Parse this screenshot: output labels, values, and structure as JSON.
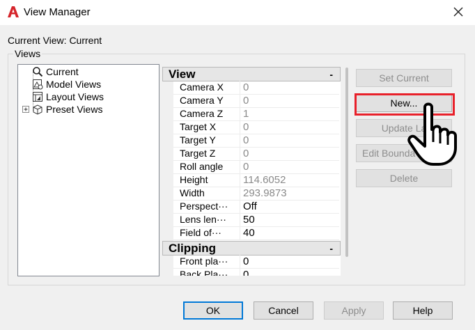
{
  "window": {
    "title": "View Manager",
    "app_icon": "autocad-a-icon",
    "close_icon": "close-icon"
  },
  "current_view_label": "Current View: Current",
  "views_group_label": "Views",
  "tree": {
    "items": [
      {
        "label": "Current",
        "icon": "magnifier-icon"
      },
      {
        "label": "Model Views",
        "icon": "model-views-icon"
      },
      {
        "label": "Layout Views",
        "icon": "layout-views-icon"
      },
      {
        "label": "Preset Views",
        "icon": "cube-icon",
        "expander": "+"
      }
    ]
  },
  "properties": {
    "view_category": "View",
    "clipping_category": "Clipping",
    "collapse_glyph": "-",
    "view_rows": [
      {
        "name": "Camera X",
        "value": "0"
      },
      {
        "name": "Camera Y",
        "value": "0"
      },
      {
        "name": "Camera Z",
        "value": "1"
      },
      {
        "name": "Target X",
        "value": "0"
      },
      {
        "name": "Target Y",
        "value": "0"
      },
      {
        "name": "Target Z",
        "value": "0"
      },
      {
        "name": "Roll angle",
        "value": "0"
      },
      {
        "name": "Height",
        "value": "114.6052"
      },
      {
        "name": "Width",
        "value": "293.9873"
      },
      {
        "name": "Perspect···",
        "value": "Off"
      },
      {
        "name": "Lens  len···",
        "value": "50"
      },
      {
        "name": "Field  of···",
        "value": "40"
      }
    ],
    "clipping_rows": [
      {
        "name": "Front  pla···",
        "value": "0"
      },
      {
        "name": "Back  Pla···",
        "value": "0"
      }
    ]
  },
  "side_buttons": {
    "set_current": "Set Current",
    "new": "New...",
    "update_layers": "Update La",
    "edit_boundaries": "Edit Bounda",
    "delete": "Delete"
  },
  "bottom_buttons": {
    "ok": "OK",
    "cancel": "Cancel",
    "apply": "Apply",
    "help": "Help"
  },
  "colors": {
    "highlight": "#e8202a",
    "default_button_border": "#0078d7",
    "app_red": "#d5252b"
  },
  "annotation_icon": "hand-pointer-icon"
}
